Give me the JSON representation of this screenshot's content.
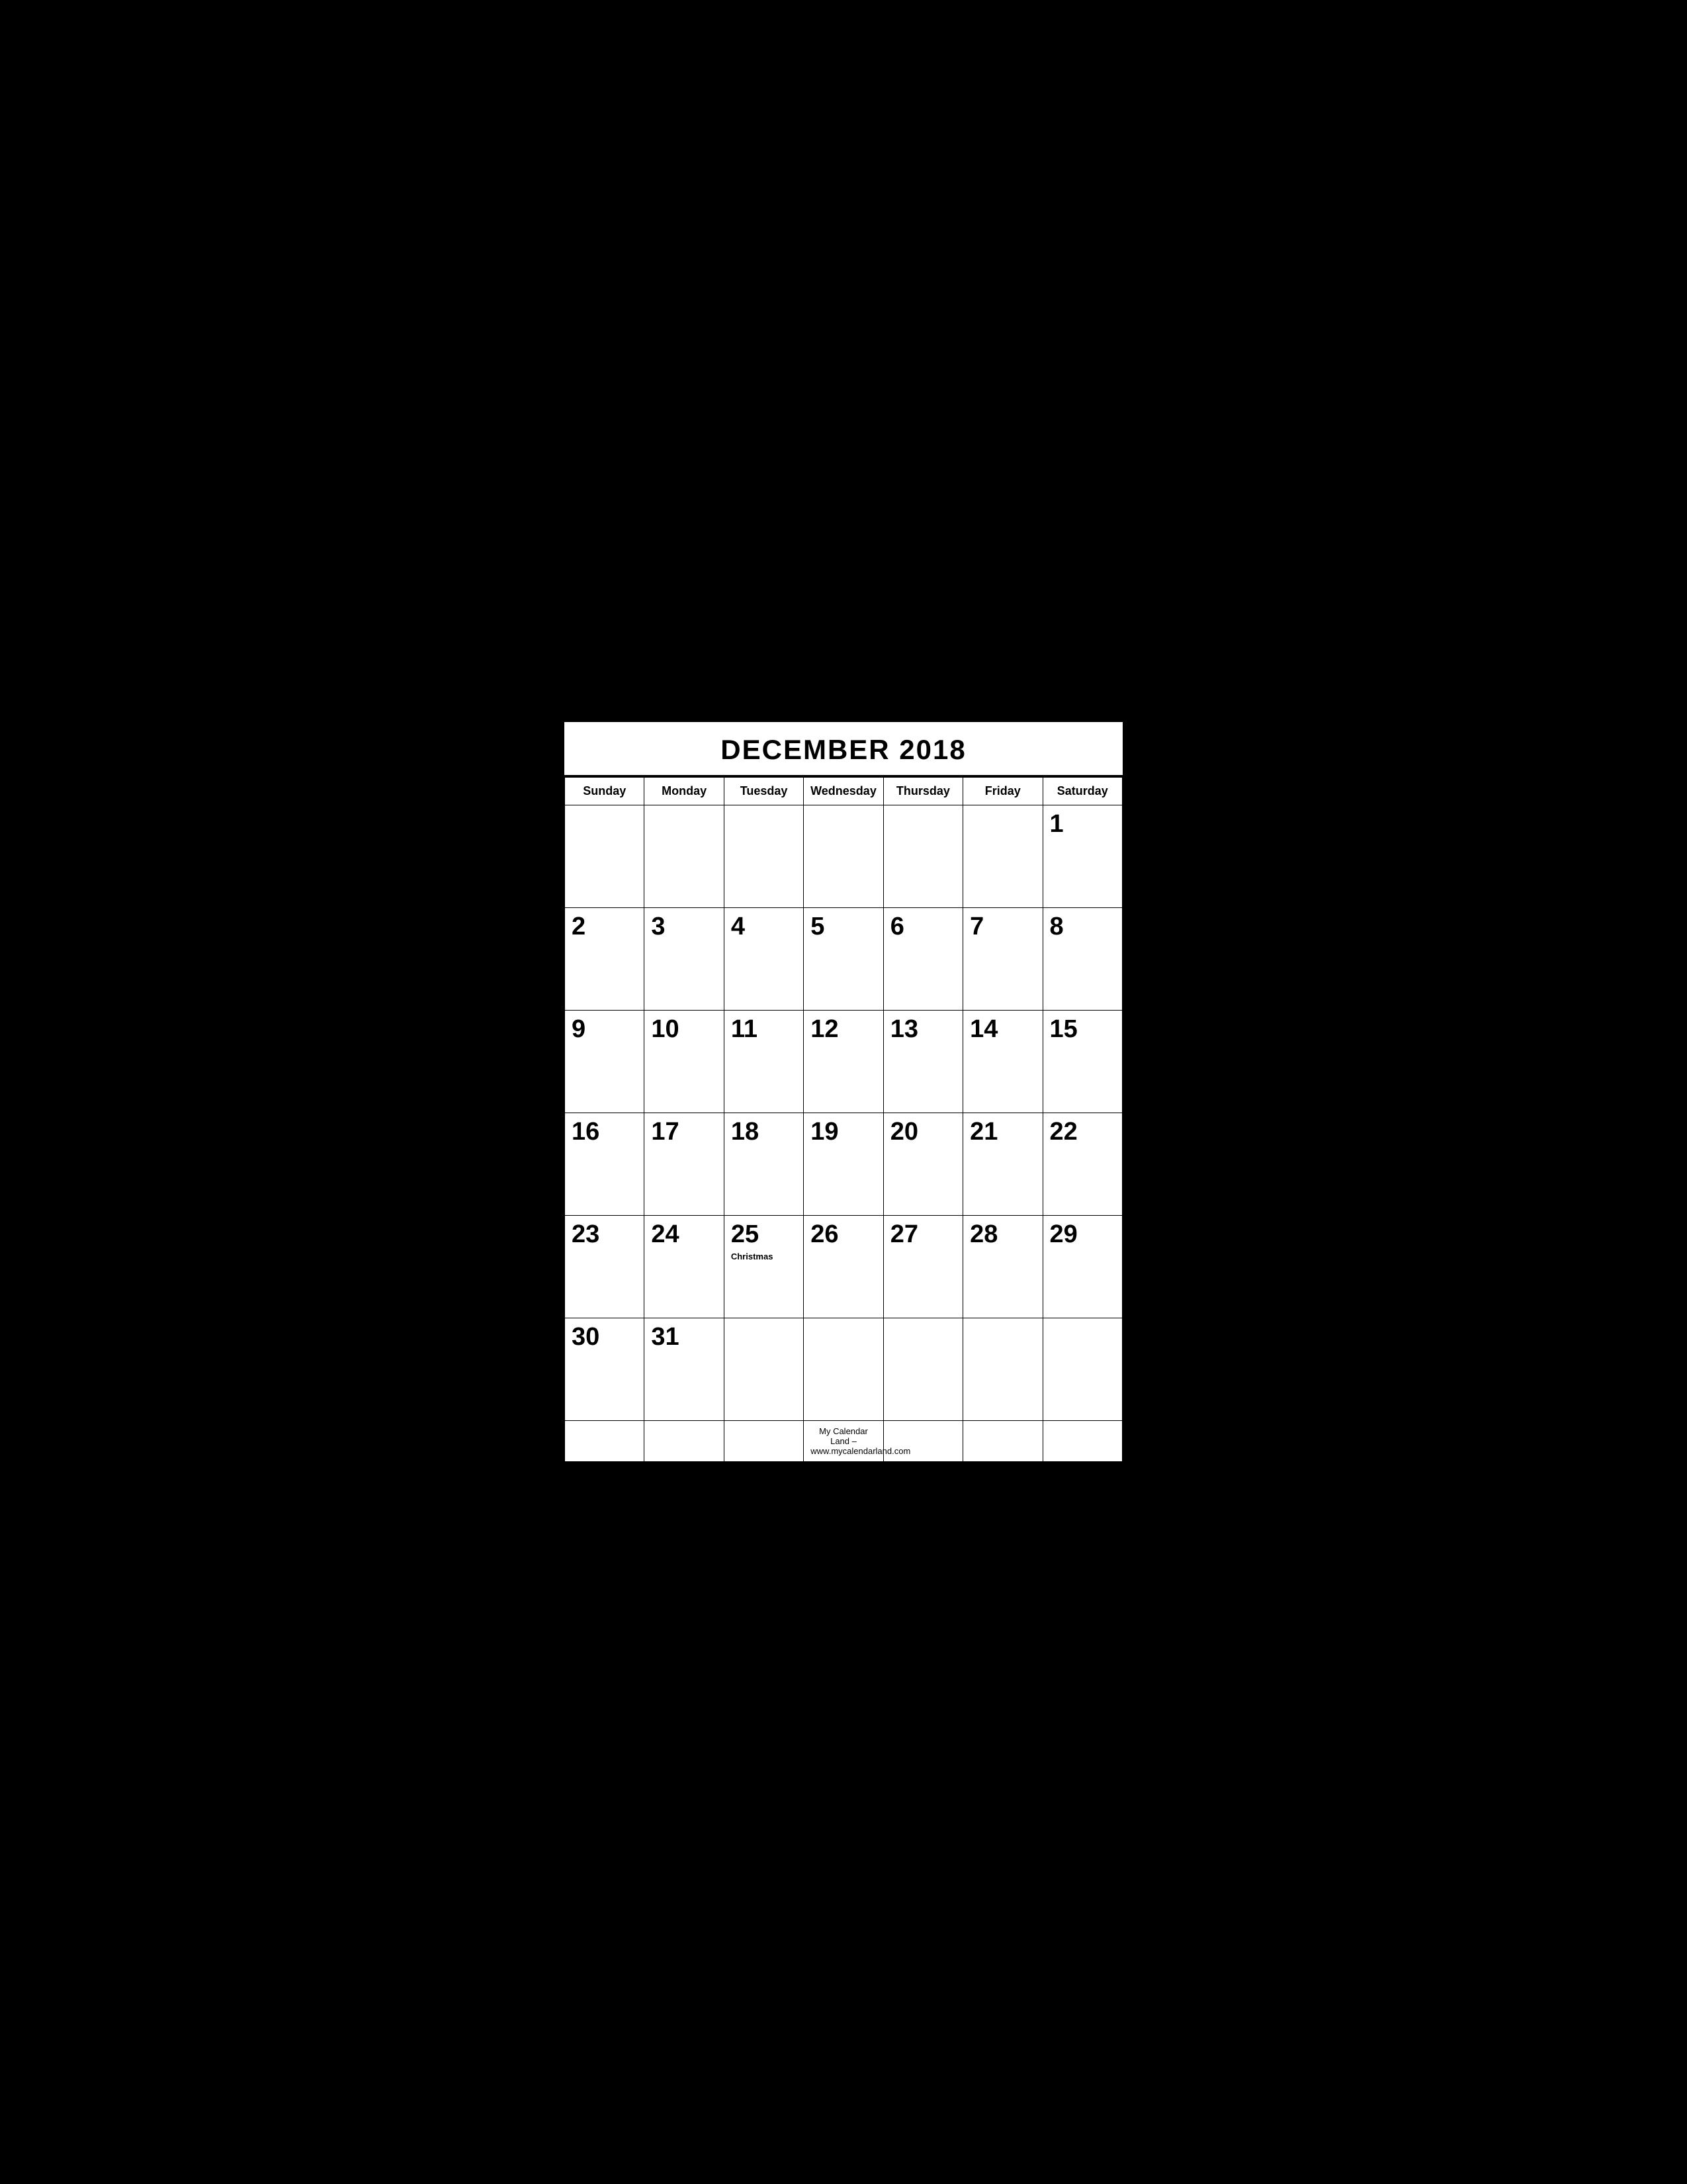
{
  "calendar": {
    "title": "DECEMBER 2018",
    "days_of_week": [
      "Sunday",
      "Monday",
      "Tuesday",
      "Wednesday",
      "Thursday",
      "Friday",
      "Saturday"
    ],
    "weeks": [
      [
        {
          "date": "",
          "holiday": ""
        },
        {
          "date": "",
          "holiday": ""
        },
        {
          "date": "",
          "holiday": ""
        },
        {
          "date": "",
          "holiday": ""
        },
        {
          "date": "",
          "holiday": ""
        },
        {
          "date": "",
          "holiday": ""
        },
        {
          "date": "1",
          "holiday": ""
        }
      ],
      [
        {
          "date": "2",
          "holiday": ""
        },
        {
          "date": "3",
          "holiday": ""
        },
        {
          "date": "4",
          "holiday": ""
        },
        {
          "date": "5",
          "holiday": ""
        },
        {
          "date": "6",
          "holiday": ""
        },
        {
          "date": "7",
          "holiday": ""
        },
        {
          "date": "8",
          "holiday": ""
        }
      ],
      [
        {
          "date": "9",
          "holiday": ""
        },
        {
          "date": "10",
          "holiday": ""
        },
        {
          "date": "11",
          "holiday": ""
        },
        {
          "date": "12",
          "holiday": ""
        },
        {
          "date": "13",
          "holiday": ""
        },
        {
          "date": "14",
          "holiday": ""
        },
        {
          "date": "15",
          "holiday": ""
        }
      ],
      [
        {
          "date": "16",
          "holiday": ""
        },
        {
          "date": "17",
          "holiday": ""
        },
        {
          "date": "18",
          "holiday": ""
        },
        {
          "date": "19",
          "holiday": ""
        },
        {
          "date": "20",
          "holiday": ""
        },
        {
          "date": "21",
          "holiday": ""
        },
        {
          "date": "22",
          "holiday": ""
        }
      ],
      [
        {
          "date": "23",
          "holiday": ""
        },
        {
          "date": "24",
          "holiday": ""
        },
        {
          "date": "25",
          "holiday": "Christmas"
        },
        {
          "date": "26",
          "holiday": ""
        },
        {
          "date": "27",
          "holiday": ""
        },
        {
          "date": "28",
          "holiday": ""
        },
        {
          "date": "29",
          "holiday": ""
        }
      ],
      [
        {
          "date": "30",
          "holiday": ""
        },
        {
          "date": "31",
          "holiday": ""
        },
        {
          "date": "",
          "holiday": ""
        },
        {
          "date": "",
          "holiday": ""
        },
        {
          "date": "",
          "holiday": ""
        },
        {
          "date": "",
          "holiday": ""
        },
        {
          "date": "",
          "holiday": ""
        }
      ]
    ],
    "footer": "My Calendar Land – www.mycalendarland.com"
  }
}
